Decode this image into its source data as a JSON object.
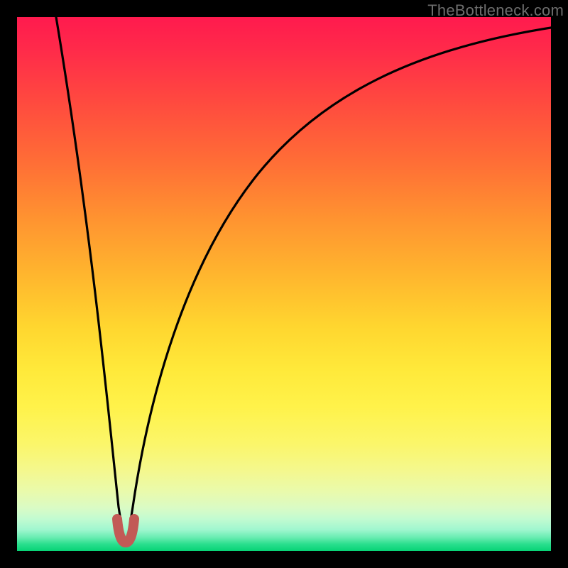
{
  "watermark": "TheBottleneck.com",
  "colors": {
    "frame": "#000000",
    "curve": "#000000",
    "marker": "#c25a56",
    "gradient_top": "#ff1a4e",
    "gradient_bottom": "#07d376"
  },
  "chart_data": {
    "type": "line",
    "title": "",
    "xlabel": "",
    "ylabel": "",
    "xlim": [
      0,
      100
    ],
    "ylim": [
      0,
      100
    ],
    "x": [
      0,
      1,
      2,
      3,
      4,
      5,
      6,
      8,
      10,
      12,
      14,
      16,
      18,
      19,
      19.5,
      20,
      20.5,
      21,
      22,
      24,
      26,
      28,
      30,
      33,
      36,
      40,
      45,
      50,
      55,
      60,
      65,
      70,
      75,
      80,
      85,
      90,
      95,
      100
    ],
    "values": [
      100,
      95,
      90,
      85,
      80,
      75,
      70,
      60,
      50,
      40,
      30,
      20,
      10,
      5,
      2.5,
      1,
      2.5,
      5,
      10,
      20,
      30,
      38,
      45,
      52,
      58,
      64,
      70,
      74,
      77.5,
      80.5,
      83,
      85,
      86.5,
      88,
      89.2,
      90.2,
      91,
      91.8
    ],
    "annotations": [
      {
        "type": "marker",
        "shape": "u-notch",
        "x": 20,
        "y": 1
      }
    ],
    "notes": "No axis ticks, labels, or legend are rendered in the image; values are estimated from the geometry of the curve on a 0–100 normalized scale. y=100 corresponds to the top (red) edge, y=0 to the bottom (green) edge."
  }
}
